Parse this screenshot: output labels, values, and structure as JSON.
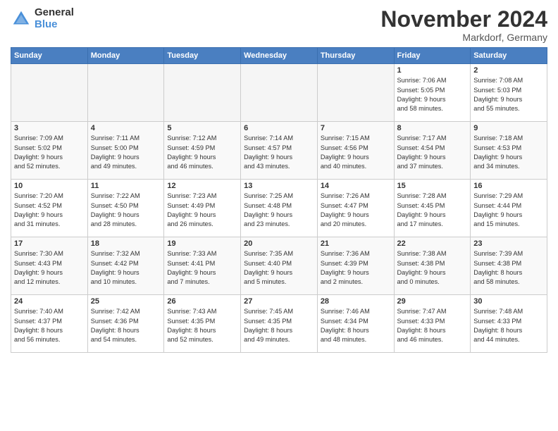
{
  "logo": {
    "general": "General",
    "blue": "Blue"
  },
  "title": "November 2024",
  "subtitle": "Markdorf, Germany",
  "days_of_week": [
    "Sunday",
    "Monday",
    "Tuesday",
    "Wednesday",
    "Thursday",
    "Friday",
    "Saturday"
  ],
  "weeks": [
    [
      {
        "day": "",
        "info": ""
      },
      {
        "day": "",
        "info": ""
      },
      {
        "day": "",
        "info": ""
      },
      {
        "day": "",
        "info": ""
      },
      {
        "day": "",
        "info": ""
      },
      {
        "day": "1",
        "info": "Sunrise: 7:06 AM\nSunset: 5:05 PM\nDaylight: 9 hours\nand 58 minutes."
      },
      {
        "day": "2",
        "info": "Sunrise: 7:08 AM\nSunset: 5:03 PM\nDaylight: 9 hours\nand 55 minutes."
      }
    ],
    [
      {
        "day": "3",
        "info": "Sunrise: 7:09 AM\nSunset: 5:02 PM\nDaylight: 9 hours\nand 52 minutes."
      },
      {
        "day": "4",
        "info": "Sunrise: 7:11 AM\nSunset: 5:00 PM\nDaylight: 9 hours\nand 49 minutes."
      },
      {
        "day": "5",
        "info": "Sunrise: 7:12 AM\nSunset: 4:59 PM\nDaylight: 9 hours\nand 46 minutes."
      },
      {
        "day": "6",
        "info": "Sunrise: 7:14 AM\nSunset: 4:57 PM\nDaylight: 9 hours\nand 43 minutes."
      },
      {
        "day": "7",
        "info": "Sunrise: 7:15 AM\nSunset: 4:56 PM\nDaylight: 9 hours\nand 40 minutes."
      },
      {
        "day": "8",
        "info": "Sunrise: 7:17 AM\nSunset: 4:54 PM\nDaylight: 9 hours\nand 37 minutes."
      },
      {
        "day": "9",
        "info": "Sunrise: 7:18 AM\nSunset: 4:53 PM\nDaylight: 9 hours\nand 34 minutes."
      }
    ],
    [
      {
        "day": "10",
        "info": "Sunrise: 7:20 AM\nSunset: 4:52 PM\nDaylight: 9 hours\nand 31 minutes."
      },
      {
        "day": "11",
        "info": "Sunrise: 7:22 AM\nSunset: 4:50 PM\nDaylight: 9 hours\nand 28 minutes."
      },
      {
        "day": "12",
        "info": "Sunrise: 7:23 AM\nSunset: 4:49 PM\nDaylight: 9 hours\nand 26 minutes."
      },
      {
        "day": "13",
        "info": "Sunrise: 7:25 AM\nSunset: 4:48 PM\nDaylight: 9 hours\nand 23 minutes."
      },
      {
        "day": "14",
        "info": "Sunrise: 7:26 AM\nSunset: 4:47 PM\nDaylight: 9 hours\nand 20 minutes."
      },
      {
        "day": "15",
        "info": "Sunrise: 7:28 AM\nSunset: 4:45 PM\nDaylight: 9 hours\nand 17 minutes."
      },
      {
        "day": "16",
        "info": "Sunrise: 7:29 AM\nSunset: 4:44 PM\nDaylight: 9 hours\nand 15 minutes."
      }
    ],
    [
      {
        "day": "17",
        "info": "Sunrise: 7:30 AM\nSunset: 4:43 PM\nDaylight: 9 hours\nand 12 minutes."
      },
      {
        "day": "18",
        "info": "Sunrise: 7:32 AM\nSunset: 4:42 PM\nDaylight: 9 hours\nand 10 minutes."
      },
      {
        "day": "19",
        "info": "Sunrise: 7:33 AM\nSunset: 4:41 PM\nDaylight: 9 hours\nand 7 minutes."
      },
      {
        "day": "20",
        "info": "Sunrise: 7:35 AM\nSunset: 4:40 PM\nDaylight: 9 hours\nand 5 minutes."
      },
      {
        "day": "21",
        "info": "Sunrise: 7:36 AM\nSunset: 4:39 PM\nDaylight: 9 hours\nand 2 minutes."
      },
      {
        "day": "22",
        "info": "Sunrise: 7:38 AM\nSunset: 4:38 PM\nDaylight: 9 hours\nand 0 minutes."
      },
      {
        "day": "23",
        "info": "Sunrise: 7:39 AM\nSunset: 4:38 PM\nDaylight: 8 hours\nand 58 minutes."
      }
    ],
    [
      {
        "day": "24",
        "info": "Sunrise: 7:40 AM\nSunset: 4:37 PM\nDaylight: 8 hours\nand 56 minutes."
      },
      {
        "day": "25",
        "info": "Sunrise: 7:42 AM\nSunset: 4:36 PM\nDaylight: 8 hours\nand 54 minutes."
      },
      {
        "day": "26",
        "info": "Sunrise: 7:43 AM\nSunset: 4:35 PM\nDaylight: 8 hours\nand 52 minutes."
      },
      {
        "day": "27",
        "info": "Sunrise: 7:45 AM\nSunset: 4:35 PM\nDaylight: 8 hours\nand 49 minutes."
      },
      {
        "day": "28",
        "info": "Sunrise: 7:46 AM\nSunset: 4:34 PM\nDaylight: 8 hours\nand 48 minutes."
      },
      {
        "day": "29",
        "info": "Sunrise: 7:47 AM\nSunset: 4:33 PM\nDaylight: 8 hours\nand 46 minutes."
      },
      {
        "day": "30",
        "info": "Sunrise: 7:48 AM\nSunset: 4:33 PM\nDaylight: 8 hours\nand 44 minutes."
      }
    ]
  ]
}
